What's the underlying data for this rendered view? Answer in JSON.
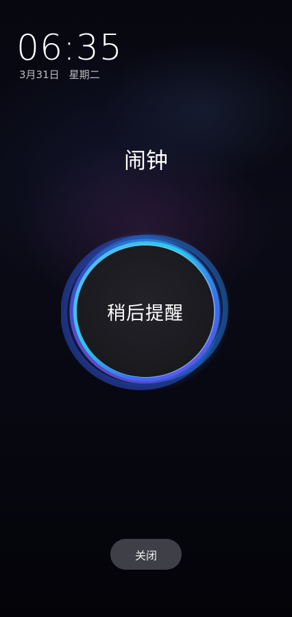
{
  "lockscreen": {
    "time": "06:35",
    "date": "3月31日",
    "weekday": "星期二"
  },
  "alarm": {
    "title": "闹钟",
    "snooze_label": "稍后提醒",
    "close_label": "关闭"
  },
  "colors": {
    "ring_cyan": "#27c9e9",
    "ring_blue": "#3a6cf0",
    "ring_purple": "#7a46e6",
    "button_fill": "#1c1c21",
    "close_button_bg": "#46464e"
  }
}
